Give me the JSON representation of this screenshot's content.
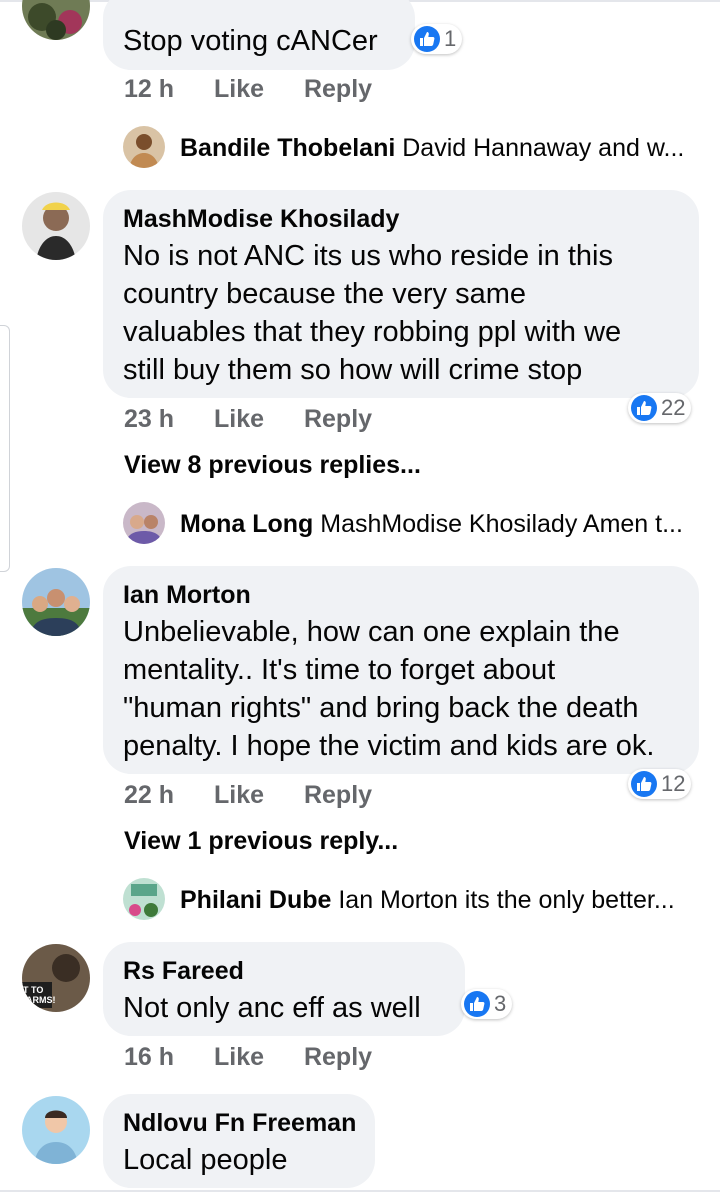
{
  "colors": {
    "accent": "#1877f2",
    "bubble": "#f0f2f5",
    "meta": "#65676b",
    "text": "#050505"
  },
  "actions": {
    "like": "Like",
    "reply": "Reply"
  },
  "comments": [
    {
      "author": "",
      "text": "Stop voting cANCer",
      "time": "12 h",
      "reactions": "1"
    },
    {
      "author": "MashModise Khosilady",
      "lines": [
        "No is not ANC its us who reside in this",
        "country because the very same",
        "valuables that they robbing ppl with we",
        "still buy them so how will crime stop"
      ],
      "time": "23 h",
      "reactions": "22"
    },
    {
      "author": "Ian Morton",
      "lines": [
        "Unbelievable, how can one explain the",
        "mentality.. It's time to forget about",
        "\"human rights\" and bring back the death",
        "penalty. I hope the victim and kids are ok."
      ],
      "time": "22 h",
      "reactions": "12"
    },
    {
      "author": "Rs Fareed",
      "text": "Not only anc eff as well",
      "time": "16 h",
      "reactions": "3",
      "avatar_text": [
        "T TO",
        "ARMS!"
      ]
    },
    {
      "author": "Ndlovu Fn Freeman",
      "text": "Local people"
    }
  ],
  "replies": [
    {
      "author": "Bandile Thobelani",
      "preview": "David Hannaway and w..."
    },
    {
      "author": "Mona Long",
      "preview": "MashModise Khosilady Amen t..."
    },
    {
      "author": "Philani Dube",
      "preview": "Ian Morton its the only better..."
    }
  ],
  "view_more": [
    "View 8 previous replies...",
    "View 1 previous reply..."
  ],
  "icons": {
    "reaction": "like-thumb-icon"
  }
}
